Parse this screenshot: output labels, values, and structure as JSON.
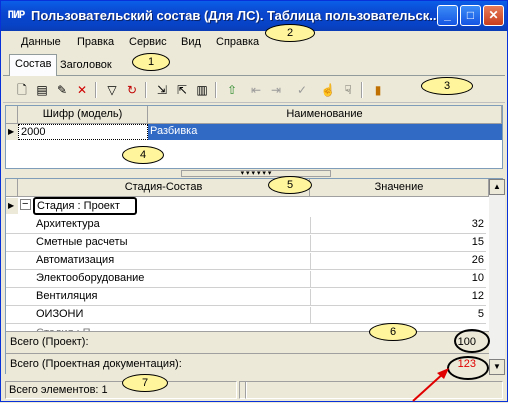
{
  "window": {
    "icon_text": "ПИР",
    "title": "Пользовательский состав (Для ЛС). Таблица пользовательск...",
    "minimize": "_",
    "maximize": "□",
    "close": "✕"
  },
  "menu": [
    "Данные",
    "Правка",
    "Сервис",
    "Вид",
    "Справка"
  ],
  "tabs": [
    "Состав",
    "Заголовок"
  ],
  "toolbar_icons": [
    "new-doc-icon",
    "properties-icon",
    "edit-icon",
    "delete-icon",
    "filter-icon",
    "refresh-icon",
    "import-icon",
    "export-icon",
    "columns-icon",
    "upload-icon",
    "indent-left-icon",
    "indent-right-icon",
    "check-icon",
    "hand-up-icon",
    "hand-down-icon",
    "exit-icon"
  ],
  "top_grid": {
    "columns": [
      "Шифр (модель)",
      "Наименование"
    ],
    "rows": [
      [
        "2000",
        "Разбивка"
      ]
    ]
  },
  "bottom_grid": {
    "columns": [
      "Стадия-Состав",
      "Значение"
    ],
    "group_label": "Стадия : Проект",
    "expand_symbol": "−",
    "rows": [
      [
        "Архитектура",
        "32"
      ],
      [
        "Сметные расчеты",
        "15"
      ],
      [
        "Автоматизация",
        "26"
      ],
      [
        "Электооборудование",
        "10"
      ],
      [
        "Вентиляция",
        "12"
      ],
      [
        "ОИЗОНИ",
        "5"
      ]
    ],
    "partial_row": "Стадия : П...",
    "totals": [
      {
        "label": "Всего (Проект):",
        "value": "100",
        "color": "#000000"
      },
      {
        "label": "Всего (Проектная документация):",
        "value": "123",
        "color": "#e00000"
      }
    ]
  },
  "status": {
    "count_text": "Всего элементов: 1"
  },
  "callouts": [
    "1",
    "2",
    "3",
    "4",
    "5",
    "6",
    "7"
  ],
  "colors": {
    "accent": "#316ac5",
    "callout_fill": "#fff59d",
    "arrow": "#e00000"
  }
}
